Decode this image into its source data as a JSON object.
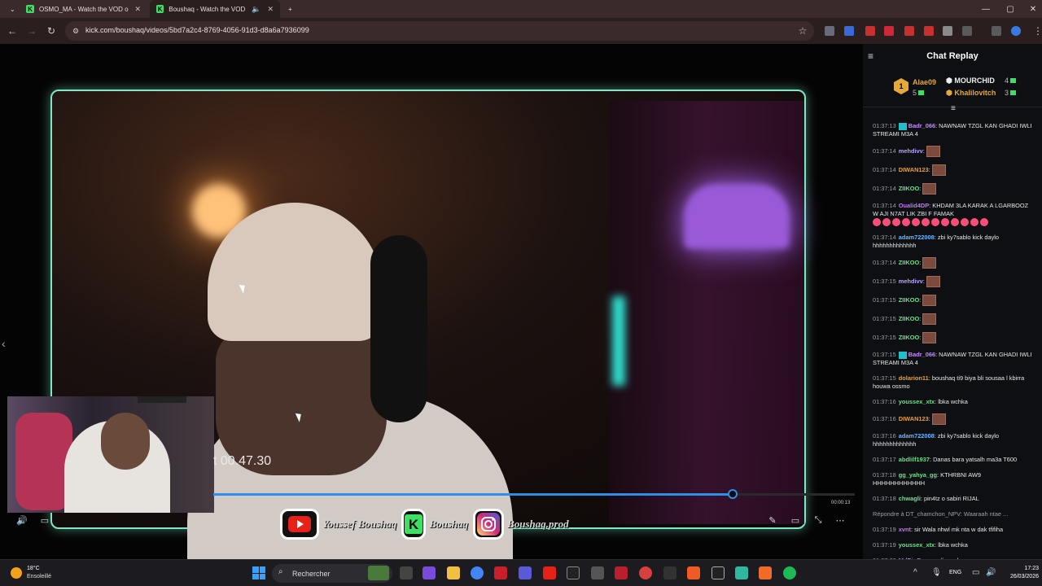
{
  "browser": {
    "tabs": [
      {
        "title": "OSMO_MA - Watch the VOD o"
      },
      {
        "title": "Boushaq - Watch the VOD"
      }
    ],
    "new_tab_symbol": "+",
    "url": "kick.com/boushaq/videos/5bd7a2c4-8769-4056-91d3-d8a6a7936099"
  },
  "video": {
    "timestamp_overlay": "t 00.47.30",
    "progress_fraction": 0.81,
    "time_end": "00:00:13",
    "socials": [
      {
        "icon": "youtube-icon",
        "name": "Youssef Boushaq"
      },
      {
        "icon": "kick-icon",
        "name": "Boushaq"
      },
      {
        "icon": "instagram-icon",
        "name": "Boushaq.prod"
      }
    ]
  },
  "chat": {
    "title": "Chat Replay",
    "leaderboard": {
      "first": {
        "rank": "1",
        "name": "Alae09",
        "count": "5"
      },
      "second": {
        "name": "MOURCHID",
        "count": "4"
      },
      "third": {
        "name": "Khalilovitch",
        "count": "3"
      }
    },
    "messages": [
      {
        "time": "01:37:13",
        "user": "Badr_066",
        "color": "#c78bff",
        "sub": true,
        "text": "NAWNAW TZGL KAN GHADI IWLI STREAMI M3A 4"
      },
      {
        "time": "01:37:14",
        "user": "mehdivv",
        "color": "#b8a6ff",
        "text": "",
        "emote": true
      },
      {
        "time": "01:37:14",
        "user": "DIWAN123",
        "color": "#f0a030",
        "text": "",
        "emote": true
      },
      {
        "time": "01:37:14",
        "user": "ZIIKOO",
        "color": "#6fe08a",
        "text": "",
        "emote": true
      },
      {
        "time": "01:37:14",
        "user": "Oualid4DP",
        "color": "#c07af0",
        "text": "KHDAM 3LA KARAK A LGARBOOZ W AJI N7AT LIK ZBI F FAMAK",
        "hearts": 12
      },
      {
        "time": "01:37:14",
        "user": "adam722008",
        "color": "#6fb6ff",
        "text": "zbi ky7sablo kick daylo hhhhhhhhhhhhh"
      },
      {
        "time": "01:37:14",
        "user": "ZIIKOO",
        "color": "#6fe08a",
        "text": "",
        "emote": true
      },
      {
        "time": "01:37:15",
        "user": "mehdivv",
        "color": "#b8a6ff",
        "text": "",
        "emote": true
      },
      {
        "time": "01:37:15",
        "user": "ZIIKOO",
        "color": "#6fe08a",
        "text": "",
        "emote": true
      },
      {
        "time": "01:37:15",
        "user": "ZIIKOO",
        "color": "#6fe08a",
        "text": "",
        "emote": true
      },
      {
        "time": "01:37:15",
        "user": "ZIIKOO",
        "color": "#6fe08a",
        "text": "",
        "emote": true
      },
      {
        "time": "01:37:15",
        "user": "Badr_066",
        "color": "#c78bff",
        "sub": true,
        "text": "NAWNAW TZGL KAN GHADI IWLI STREAMI M3A 4"
      },
      {
        "time": "01:37:15",
        "user": "dolarion11",
        "color": "#f0a030",
        "text": "boushaq ti9 biya bli sousaa l kbirra houwa ossmo"
      },
      {
        "time": "01:37:16",
        "user": "youssex_xtx",
        "color": "#6fe08a",
        "text": "lbka wchka"
      },
      {
        "time": "01:37:16",
        "user": "DIWAN123",
        "color": "#f0a030",
        "text": "",
        "emote": true
      },
      {
        "time": "01:37:16",
        "user": "adam722008",
        "color": "#6fb6ff",
        "text": "zbi ky7sablo kick daylo hhhhhhhhhhhhh"
      },
      {
        "time": "01:37:17",
        "user": "abdlilf1937",
        "color": "#6fe08a",
        "text": "Danas bara yatsalh ma3a T600"
      },
      {
        "time": "01:37:18",
        "user": "gg_yahya_gg",
        "color": "#6fe08a",
        "text": "KTHRBNI AW9 HHHHHHHHHHHH"
      },
      {
        "time": "01:37:18",
        "user": "chwagli",
        "color": "#6fe08a",
        "text": "pin4tz o sabiri RIJAL"
      },
      {
        "time": "",
        "user": "",
        "color": "#9aa0a6",
        "text": "Répondre à DT_chamchon_NPV: Waaraah ntae ..."
      },
      {
        "time": "01:37:19",
        "user": "xvnt",
        "color": "#c07af0",
        "text": "sir Wala nhwl mk nta w dak tfifiha"
      },
      {
        "time": "01:37:19",
        "user": "youssex_xtx",
        "color": "#6fe08a",
        "text": "lbka wchka"
      },
      {
        "time": "01:37:20",
        "user": "MdDinBs",
        "color": "#c07af0",
        "text": "svp discord"
      }
    ]
  },
  "taskbar": {
    "temperature": "18°C",
    "weather": "Ensoleillé",
    "search_label": "Rechercher",
    "language": "ENG",
    "time": "17:23",
    "date": "26/03/2026"
  }
}
